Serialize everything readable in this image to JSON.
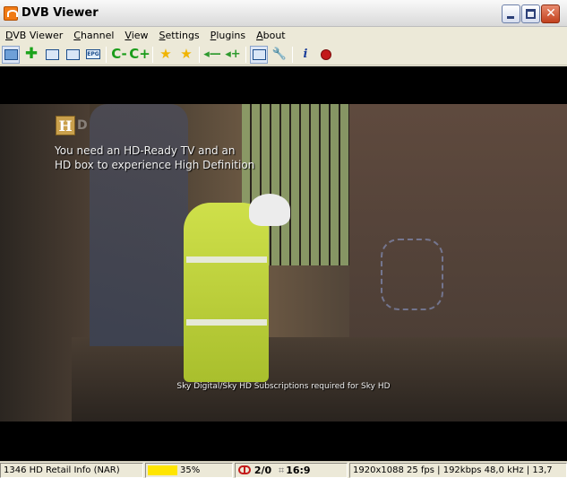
{
  "window": {
    "title": "DVB Viewer",
    "buttons": {
      "minimize": "minimize",
      "maximize": "maximize",
      "close": "✕"
    }
  },
  "menu": [
    {
      "label": "DVB Viewer",
      "accel": "D",
      "rest": "VB Viewer"
    },
    {
      "label": "Channel",
      "accel": "C",
      "rest": "hannel"
    },
    {
      "label": "View",
      "accel": "V",
      "rest": "iew"
    },
    {
      "label": "Settings",
      "accel": "S",
      "rest": "ettings"
    },
    {
      "label": "Plugins",
      "accel": "P",
      "rest": "lugins"
    },
    {
      "label": "About",
      "accel": "A",
      "rest": "bout"
    }
  ],
  "toolbar": {
    "epg_label": "EPG",
    "icons": [
      "screen-icon",
      "add-icon",
      "teletext-icon",
      "osd-icon",
      "epg-icon",
      "channel-prev-icon",
      "channel-next-icon",
      "favorite-icon",
      "favorites-icon",
      "volume-down-icon",
      "volume-up-icon",
      "snapshot-icon",
      "wrench-icon",
      "info-icon",
      "record-icon"
    ]
  },
  "video": {
    "overlay_logo": "H",
    "overlay_logo_suffix": "D",
    "overlay_line1": "You need an HD-Ready TV and an",
    "overlay_line2": "HD box to experience High Definition",
    "subtitle": "Sky Digital/Sky HD Subscriptions required for Sky HD"
  },
  "status": {
    "channel": "1346 HD Retail Info (NAR)",
    "signal_percent": 35,
    "signal_label": "35%",
    "signal_color": "#ffe500",
    "record_count": "2/0",
    "aspect": "16:9",
    "stream_info": "1920x1088 25 fps | 192kbps 48,0 kHz | 13,7"
  },
  "colors": {
    "chrome": "#ece9d8",
    "record_red": "#c31a1a"
  }
}
